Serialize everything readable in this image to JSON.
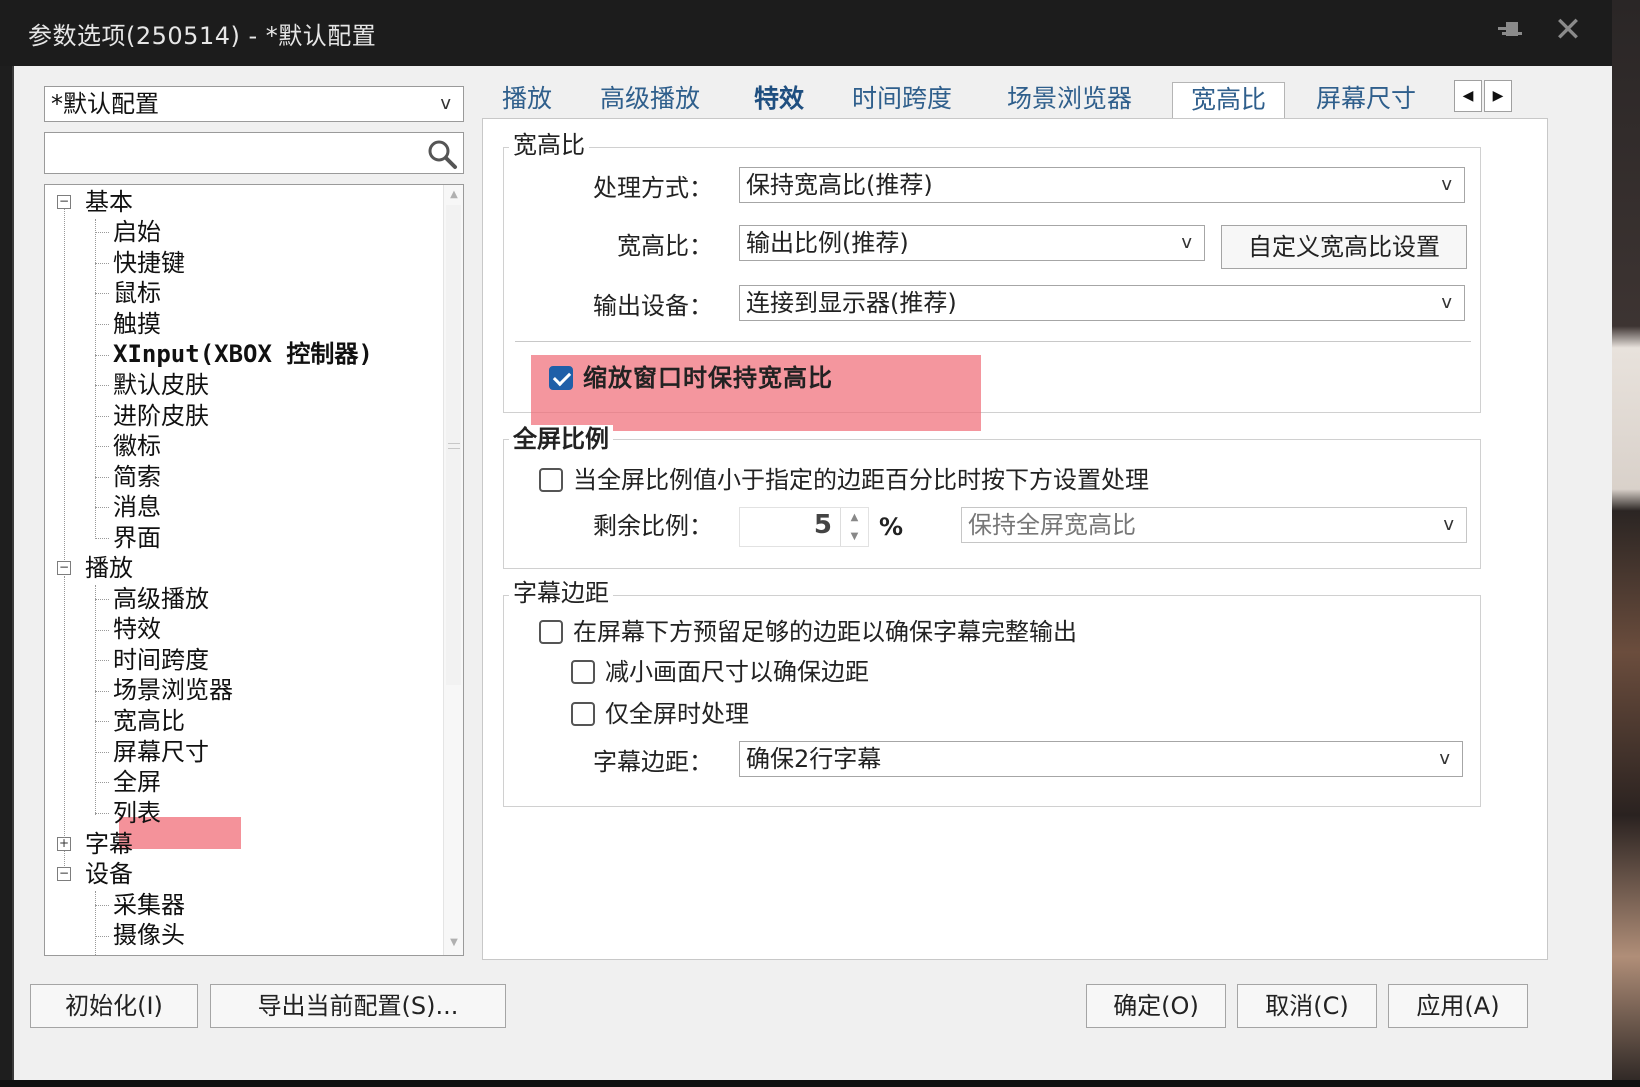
{
  "window": {
    "title": "参数选项(250514) - *默认配置",
    "pin_icon": "pin-icon",
    "close_icon": "close-icon",
    "close_glyph": "✕"
  },
  "sidebar": {
    "profile": "*默认配置",
    "profile_arrow": "v",
    "search_placeholder": "",
    "tree": [
      {
        "label": "基本",
        "expander": "−",
        "children": [
          "启始",
          "快捷键",
          "鼠标",
          "触摸",
          "XInput(XBOX 控制器)",
          "默认皮肤",
          "进阶皮肤",
          "徽标",
          "简索",
          "消息",
          "界面"
        ]
      },
      {
        "label": "播放",
        "expander": "−",
        "children": [
          "高级播放",
          "特效",
          "时间跨度",
          "场景浏览器",
          "宽高比",
          "屏幕尺寸",
          "全屏",
          "列表"
        ]
      },
      {
        "label": "字幕",
        "expander": "+",
        "children": []
      },
      {
        "label": "设备",
        "expander": "−",
        "children": [
          "采集器",
          "摄像头"
        ]
      }
    ],
    "selected": "宽高比"
  },
  "tabs": [
    {
      "label": "播放"
    },
    {
      "label": "高级播放"
    },
    {
      "label": "特效"
    },
    {
      "label": "时间跨度"
    },
    {
      "label": "场景浏览器"
    },
    {
      "label": "宽高比"
    },
    {
      "label": "屏幕尺寸"
    }
  ],
  "tab_scroll": {
    "left": "◀",
    "right": "▶"
  },
  "aspect_group": {
    "title": "宽高比",
    "method_label": "处理方式：",
    "method_value": "保持宽高比(推荐)",
    "ratio_label": "宽高比：",
    "ratio_value": "输出比例(推荐)",
    "custom_button": "自定义宽高比设置",
    "device_label": "输出设备：",
    "device_value": "连接到显示器(推荐)",
    "keep_on_resize": "缩放窗口时保持宽高比",
    "keep_on_resize_checked": true,
    "arrow": "v"
  },
  "fullscreen_group": {
    "title": "全屏比例",
    "check_label": "当全屏比例值小于指定的边距百分比时按下方设置处理",
    "remain_label": "剩余比例：",
    "remain_value": "5",
    "unit": "%",
    "mode_value": "保持全屏宽高比"
  },
  "subtitle_group": {
    "title": "字幕边距",
    "reserve_label": "在屏幕下方预留足够的边距以确保字幕完整输出",
    "shrink_label": "减小画面尺寸以确保边距",
    "fullscreen_only_label": "仅全屏时处理",
    "margin_label": "字幕边距：",
    "margin_value": "确保2行字幕"
  },
  "footer": {
    "reset": "初始化(I)",
    "export": "导出当前配置(S)...",
    "ok": "确定(O)",
    "cancel": "取消(C)",
    "apply": "应用(A)"
  },
  "colors": {
    "highlight": "#f06e78",
    "tab_text": "#2f5f8c",
    "checkbox_checked": "#1f5fa8"
  }
}
